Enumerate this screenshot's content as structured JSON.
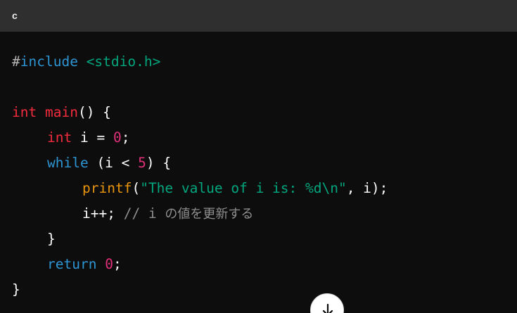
{
  "header": {
    "language": "c"
  },
  "code": {
    "l1_hash": "#",
    "l1_kw": "include",
    "l1_space": " ",
    "l1_header": "<stdio.h>",
    "l3_type": "int",
    "l3_sp": " ",
    "l3_fn": "main",
    "l3_rest": "() {",
    "l4_type": "int",
    "l4_a": " i = ",
    "l4_num": "0",
    "l4_b": ";",
    "l5_kw": "while",
    "l5_a": " (i < ",
    "l5_num": "5",
    "l5_b": ") {",
    "l6_fn": "printf",
    "l6_a": "(",
    "l6_str": "\"The value of i is: %d\\n\"",
    "l6_b": ", i);",
    "l7_code": "i++; ",
    "l7_cmt": "// i ",
    "l7_cmt_ja": "の値を更新する",
    "l8_brace": "}",
    "l9_kw": "return",
    "l9_sp": " ",
    "l9_num": "0",
    "l9_b": ";",
    "l10_brace": "}"
  },
  "scroll_button": {
    "icon": "arrow-down-icon"
  },
  "colors": {
    "background": "#0d0d0d",
    "header": "#2f2f2f",
    "keyword": "#2e95d3",
    "type": "#f22c3d",
    "number": "#df3079",
    "string": "#00a67d",
    "function_call": "#e9950c",
    "comment": "#8e8e8e"
  }
}
